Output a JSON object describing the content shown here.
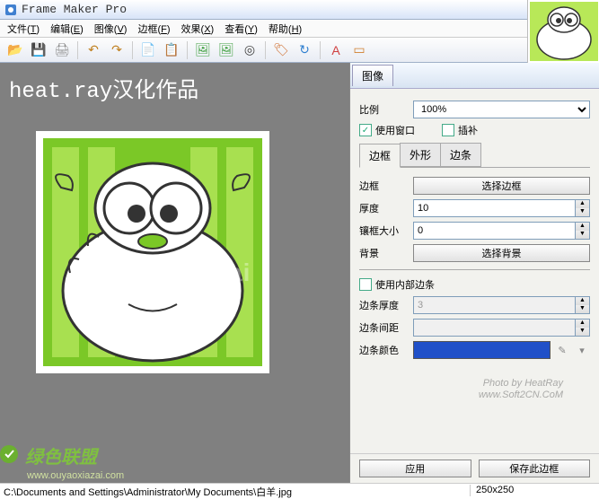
{
  "title": "Frame Maker Pro",
  "menu": [
    {
      "label": "文件",
      "key": "T"
    },
    {
      "label": "编辑",
      "key": "E"
    },
    {
      "label": "图像",
      "key": "V"
    },
    {
      "label": "边框",
      "key": "F"
    },
    {
      "label": "效果",
      "key": "X"
    },
    {
      "label": "查看",
      "key": "Y"
    },
    {
      "label": "帮助",
      "key": "H"
    }
  ],
  "toolbar_icons": [
    {
      "name": "open-icon",
      "glyph": "📂",
      "color": "#e8a030"
    },
    {
      "name": "save-icon",
      "glyph": "💾",
      "color": "#3070c0"
    },
    {
      "name": "print-icon",
      "glyph": "🖨",
      "color": "#888"
    },
    {
      "sep": true
    },
    {
      "name": "undo-icon",
      "glyph": "↶",
      "color": "#c08020"
    },
    {
      "name": "redo-icon",
      "glyph": "↷",
      "color": "#c08020"
    },
    {
      "sep": true
    },
    {
      "name": "copy-icon",
      "glyph": "📄",
      "color": "#3080d0"
    },
    {
      "name": "paste-icon",
      "glyph": "📋",
      "color": "#3080d0"
    },
    {
      "sep": true
    },
    {
      "name": "image-icon",
      "glyph": "🖼",
      "color": "#40a040"
    },
    {
      "name": "image2-icon",
      "glyph": "🖼",
      "color": "#40a040"
    },
    {
      "name": "target-icon",
      "glyph": "◎",
      "color": "#404040"
    },
    {
      "sep": true
    },
    {
      "name": "tag-icon",
      "glyph": "🏷",
      "color": "#d07030"
    },
    {
      "name": "refresh-icon",
      "glyph": "↻",
      "color": "#3080d0"
    },
    {
      "sep": true
    },
    {
      "name": "text-icon",
      "glyph": "A",
      "color": "#d04040"
    },
    {
      "name": "frame-icon",
      "glyph": "▭",
      "color": "#d08030"
    }
  ],
  "canvas": {
    "title": "heat.ray汉化作品",
    "watermark": "ouyaoxiazai",
    "footer_text": "绿色联盟",
    "footer_url": "www.ouyaoxiazai.com"
  },
  "side": {
    "main_tab": "图像",
    "ratio_label": "比例",
    "ratio_value": "100%",
    "use_window": "使用窗口",
    "interp": "插补",
    "subtabs": [
      "边框",
      "外形",
      "边条"
    ],
    "frame": {
      "label_frame": "边框",
      "btn_select_frame": "选择边框",
      "label_thickness": "厚度",
      "val_thickness": "10",
      "label_bevel": "镶框大小",
      "val_bevel": "0",
      "label_bg": "背景",
      "btn_select_bg": "选择背景",
      "use_inner": "使用内部边条",
      "label_strip_thickness": "边条厚度",
      "val_strip_thickness": "3",
      "label_strip_gap": "边条间距",
      "label_strip_color": "边条颜色",
      "strip_color": "#2050c8"
    },
    "btn_apply": "应用",
    "btn_save": "保存此边框",
    "wm_line1": "Photo by HeatRay",
    "wm_line2": "www.Soft2CN.CoM"
  },
  "status": {
    "path": "C:\\Documents and Settings\\Administrator\\My Documents\\白羊.jpg",
    "dim": "250x250"
  }
}
